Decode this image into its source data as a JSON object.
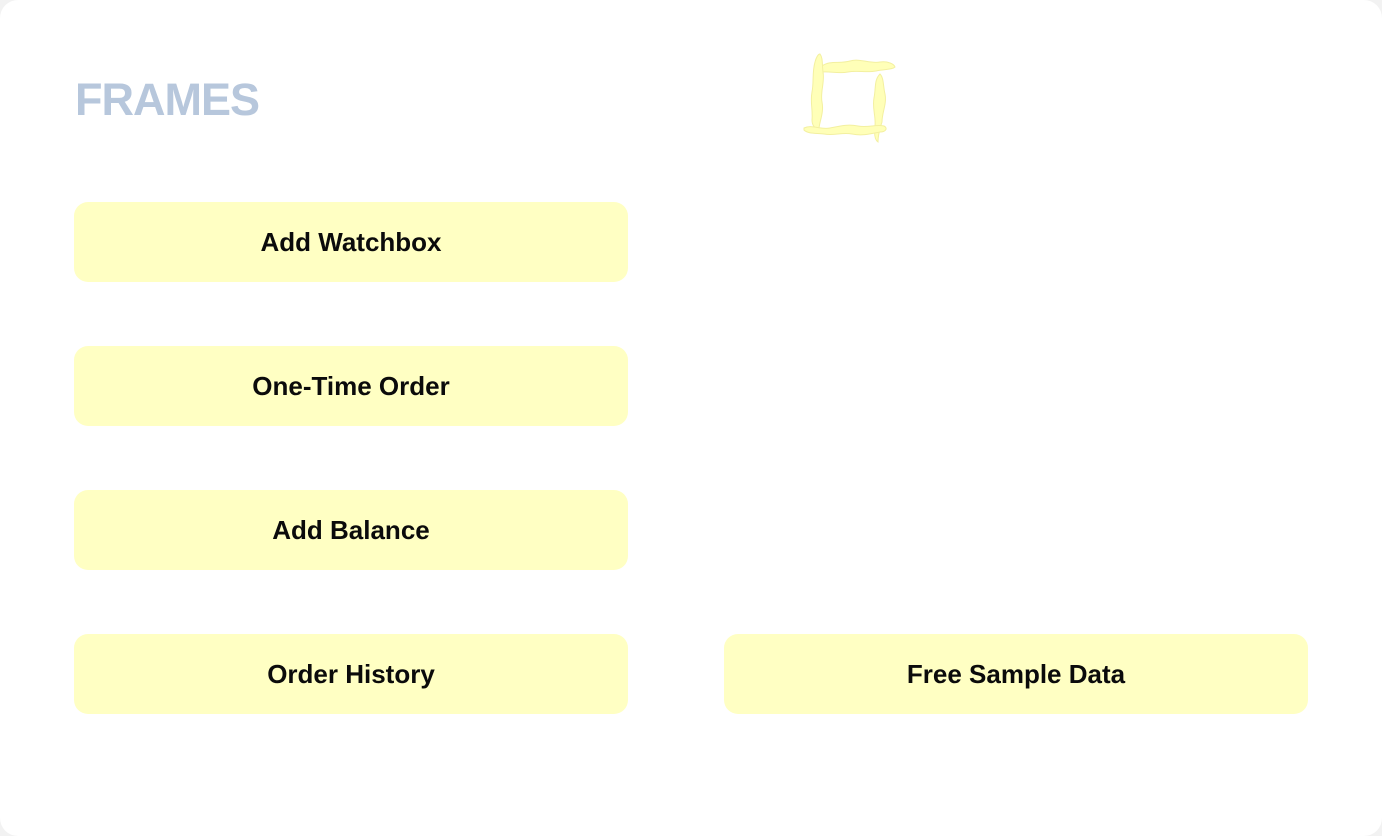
{
  "header": {
    "title": "FRAMES",
    "logo_icon": "frame-logo-icon",
    "logo_color": "#ffffb8",
    "title_color": "#b7c7dc"
  },
  "buttons": {
    "add_watchbox": "Add Watchbox",
    "one_time_order": "One-Time Order",
    "add_balance": "Add Balance",
    "order_history": "Order History",
    "free_sample_data": "Free Sample Data"
  },
  "colors": {
    "button_bg": "#ffffc3",
    "button_text": "#0b0b0b",
    "background": "#ffffff"
  }
}
